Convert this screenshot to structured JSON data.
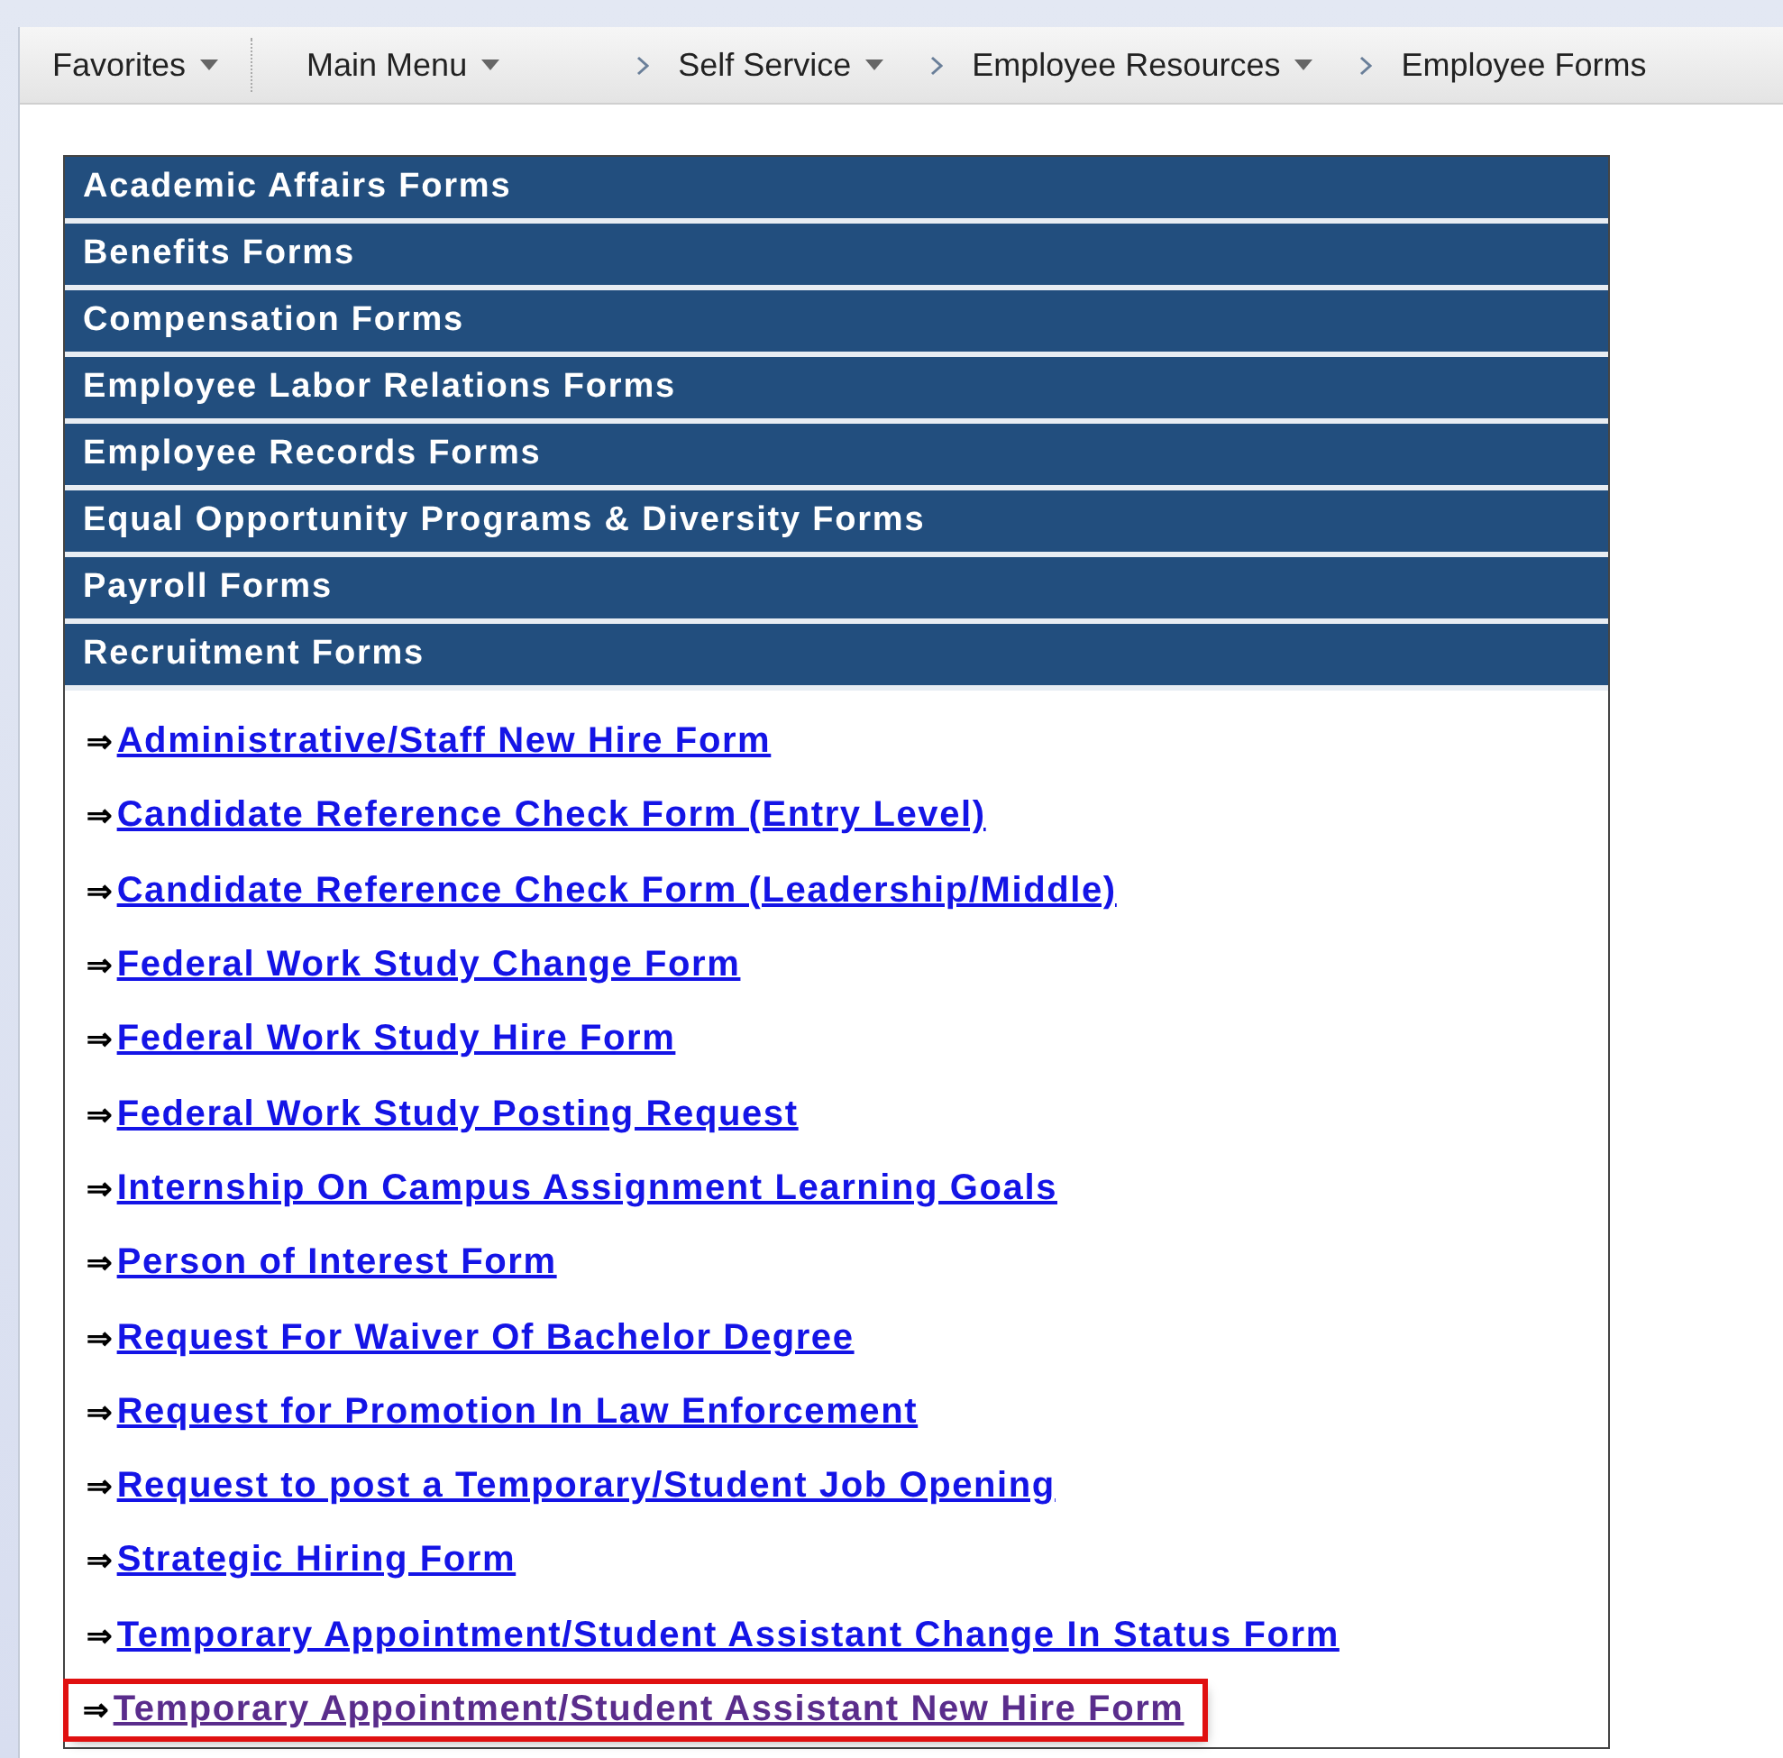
{
  "nav": {
    "favorites": {
      "label": "Favorites",
      "has_menu": true
    },
    "breadcrumbs": [
      {
        "label": "Main Menu",
        "has_menu": true
      },
      {
        "label": "Self Service",
        "has_menu": true
      },
      {
        "label": "Employee Resources",
        "has_menu": true
      },
      {
        "label": "Employee Forms",
        "has_menu": false
      }
    ]
  },
  "sections": [
    {
      "title": "Academic Affairs Forms"
    },
    {
      "title": "Benefits Forms"
    },
    {
      "title": "Compensation Forms"
    },
    {
      "title": "Employee Labor Relations Forms"
    },
    {
      "title": "Employee Records Forms"
    },
    {
      "title": "Equal Opportunity Programs & Diversity Forms"
    },
    {
      "title": "Payroll Forms"
    },
    {
      "title": "Recruitment Forms",
      "links": [
        {
          "marker": "⇒",
          "label": "Administrative/Staff New Hire Form",
          "visited": false,
          "highlighted": false
        },
        {
          "marker": "⇒",
          "label": "Candidate Reference Check Form (Entry Level)",
          "visited": false,
          "highlighted": false
        },
        {
          "marker": "⇒",
          "label": "Candidate Reference Check Form (Leadership/Middle)",
          "visited": false,
          "highlighted": false
        },
        {
          "marker": "⇒",
          "label": "Federal Work Study Change Form",
          "visited": false,
          "highlighted": false
        },
        {
          "marker": "⇒",
          "label": "Federal Work Study Hire Form",
          "visited": false,
          "highlighted": false
        },
        {
          "marker": "⇒",
          "label": "Federal Work Study Posting Request",
          "visited": false,
          "highlighted": false
        },
        {
          "marker": "⇒",
          "label": "Internship On Campus Assignment Learning Goals",
          "visited": false,
          "highlighted": false
        },
        {
          "marker": "⇒",
          "label": "Person of Interest Form",
          "visited": false,
          "highlighted": false
        },
        {
          "marker": "⇒",
          "label": "Request For Waiver Of Bachelor Degree",
          "visited": false,
          "highlighted": false
        },
        {
          "marker": "⇒",
          "label": "Request for Promotion In Law Enforcement",
          "visited": false,
          "highlighted": false
        },
        {
          "marker": "⇒",
          "label": "Request to post a Temporary/Student Job Opening",
          "visited": false,
          "highlighted": false
        },
        {
          "marker": "⇒",
          "label": "Strategic Hiring Form",
          "visited": false,
          "highlighted": false
        },
        {
          "marker": "⇒",
          "label": "Temporary Appointment/Student Assistant Change In Status Form",
          "visited": false,
          "highlighted": false
        },
        {
          "marker": "⇒",
          "label": "Temporary Appointment/Student Assistant New Hire Form",
          "visited": true,
          "highlighted": true
        }
      ]
    }
  ]
}
